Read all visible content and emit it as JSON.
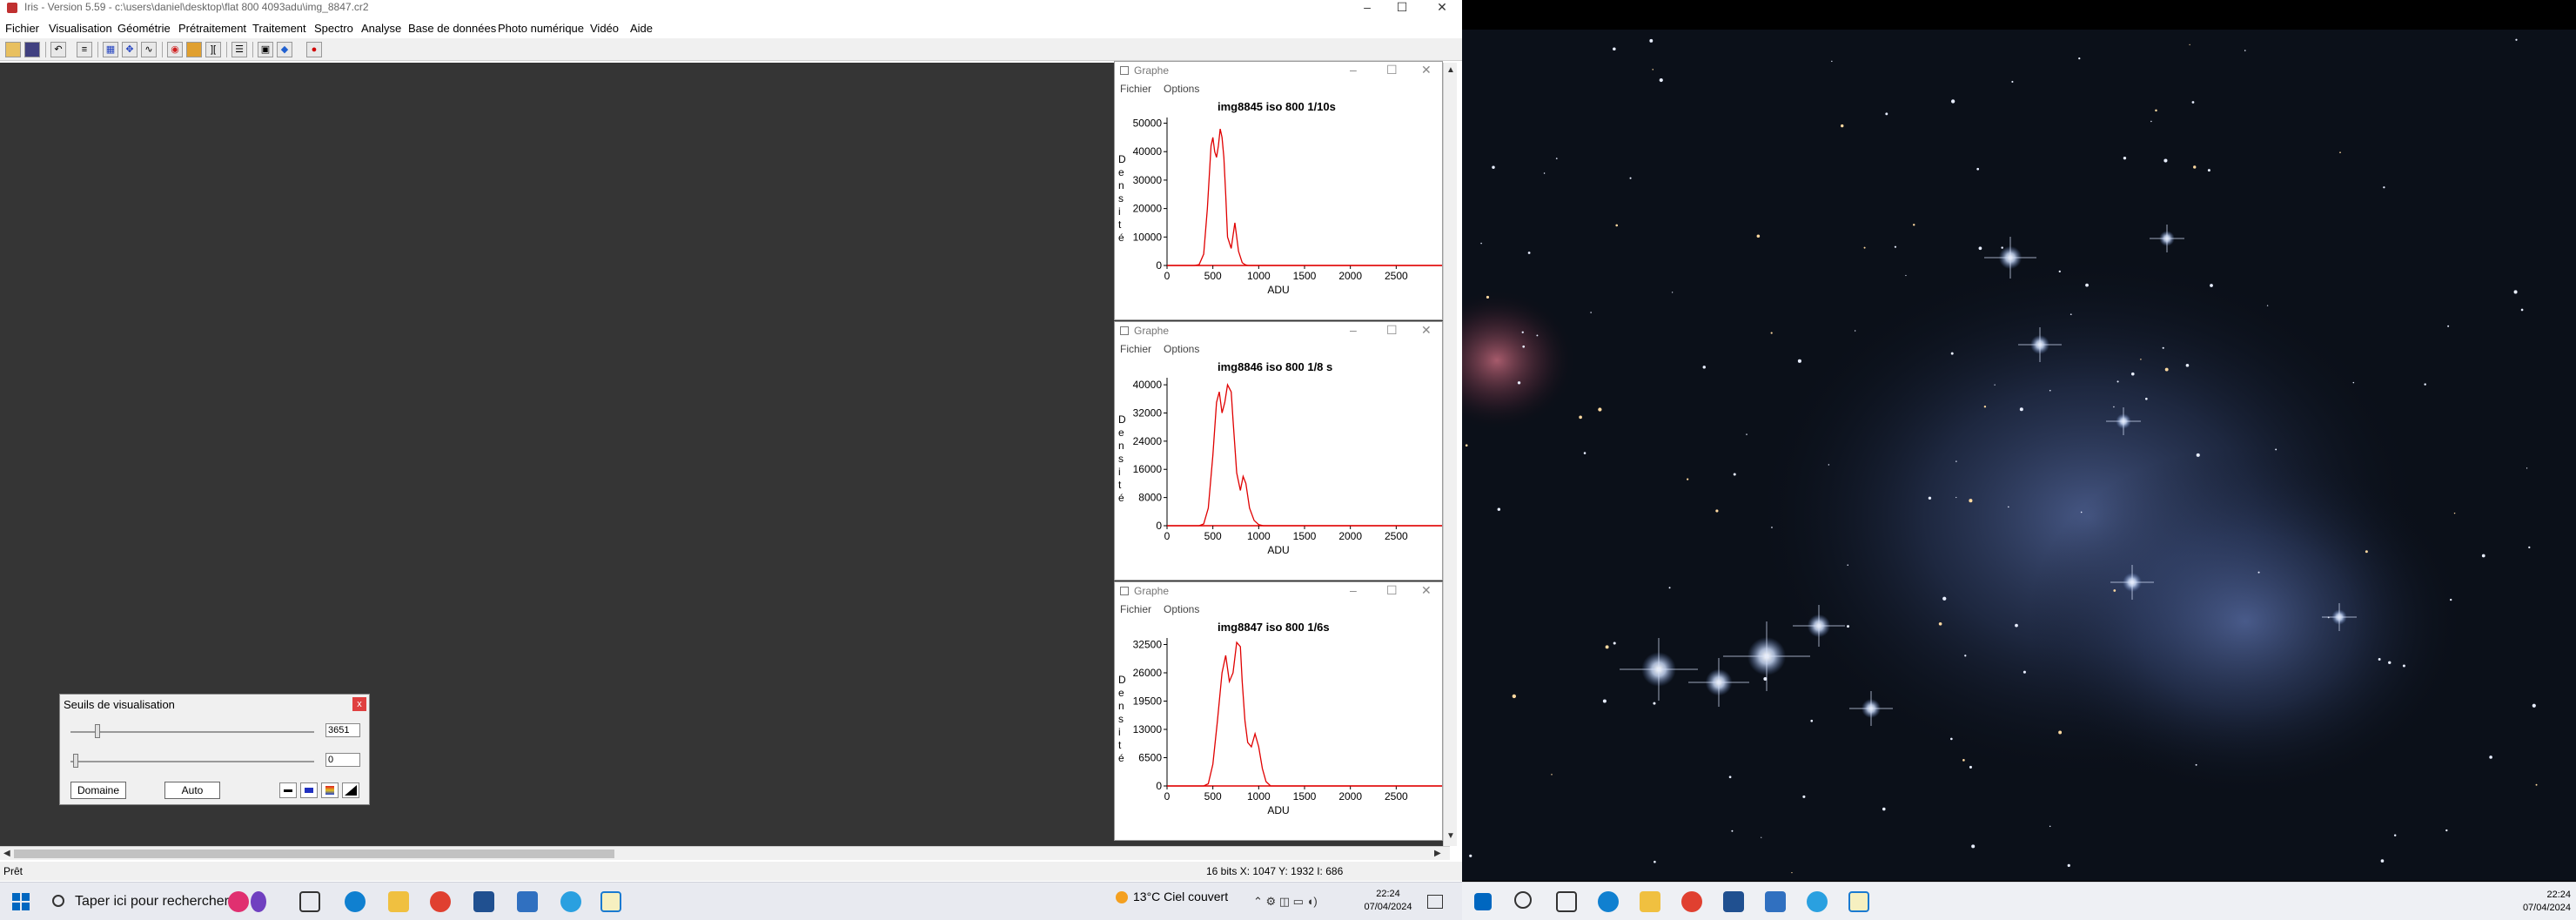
{
  "window": {
    "title": "Iris - Version 5.59 - c:\\users\\daniel\\desktop\\flat 800 4093adu\\img_8847.cr2",
    "controls": [
      "–",
      "☐",
      "✕"
    ]
  },
  "menubar": {
    "items": [
      "Fichier",
      "Visualisation",
      "Géométrie",
      "Prétraitement",
      "Traitement",
      "Spectro",
      "Analyse",
      "Base de données",
      "Photo numérique",
      "Vidéo",
      "Aide"
    ]
  },
  "graphs": [
    {
      "window_title": "Graphe",
      "menu": [
        "Fichier",
        "Options"
      ],
      "chart_data": {
        "type": "line",
        "title": "img8845 iso 800   1/10s",
        "xlabel": "ADU",
        "ylabel": "Densité",
        "xlim": [
          0,
          3000
        ],
        "ylim": [
          0,
          52000
        ],
        "yticks": [
          0,
          10000,
          20000,
          30000,
          40000,
          50000
        ],
        "xticks": [
          0,
          500,
          1000,
          1500,
          2000,
          2500
        ],
        "series": [
          {
            "x": [
              0,
              300,
              350,
              400,
              440,
              480,
              500,
              520,
              540,
              560,
              580,
              600,
              620,
              640,
              660,
              700,
              740,
              780,
              800,
              820,
              850,
              880,
              950,
              3000
            ],
            "values": [
              0,
              0,
              300,
              4000,
              20000,
              42000,
              45000,
              40000,
              38000,
              42000,
              48000,
              45000,
              38000,
              25000,
              10000,
              6000,
              15000,
              5000,
              3000,
              1000,
              300,
              0,
              0,
              0
            ]
          }
        ]
      }
    },
    {
      "window_title": "Graphe",
      "menu": [
        "Fichier",
        "Options"
      ],
      "chart_data": {
        "type": "line",
        "title": "img8846 iso 800   1/8 s",
        "xlabel": "ADU",
        "ylabel": "Densité",
        "xlim": [
          0,
          3000
        ],
        "ylim": [
          0,
          42000
        ],
        "yticks": [
          0,
          8000,
          16000,
          24000,
          32000,
          40000
        ],
        "xticks": [
          0,
          500,
          1000,
          1500,
          2000,
          2500
        ],
        "series": [
          {
            "x": [
              0,
              350,
              400,
              450,
              500,
              540,
              570,
              600,
              630,
              660,
              700,
              720,
              760,
              800,
              830,
              860,
              900,
              950,
              1000,
              1050,
              3000
            ],
            "values": [
              0,
              0,
              500,
              5000,
              20000,
              35000,
              38000,
              32000,
              35000,
              40000,
              38000,
              30000,
              15000,
              10000,
              14000,
              12000,
              5000,
              1500,
              300,
              0,
              0
            ]
          }
        ]
      }
    },
    {
      "window_title": "Graphe",
      "menu": [
        "Fichier",
        "Options"
      ],
      "chart_data": {
        "type": "line",
        "title": "img8847 iso 800   1/6s",
        "xlabel": "ADU",
        "ylabel": "Densité",
        "xlim": [
          0,
          3000
        ],
        "ylim": [
          0,
          34000
        ],
        "yticks": [
          0,
          6500,
          13000,
          19500,
          26000,
          32500
        ],
        "xticks": [
          0,
          500,
          1000,
          1500,
          2000,
          2500
        ],
        "series": [
          {
            "x": [
              0,
              400,
              450,
              500,
              550,
              600,
              640,
              680,
              720,
              760,
              800,
              820,
              850,
              880,
              920,
              960,
              1000,
              1040,
              1080,
              1130,
              3000
            ],
            "values": [
              0,
              0,
              500,
              5000,
              15000,
              26000,
              30000,
              24000,
              26000,
              33000,
              32000,
              24000,
              15000,
              10000,
              9000,
              12000,
              9000,
              4000,
              1000,
              0,
              0
            ]
          }
        ]
      }
    }
  ],
  "threshold_dialog": {
    "title": "Seuils de visualisation",
    "close": "x",
    "high_value": "3651",
    "low_value": "0",
    "high_level": 0.11,
    "low_level": 0.02,
    "domain_button": "Domaine",
    "auto_button": "Auto"
  },
  "statusbar": {
    "left": "Prêt",
    "info": "16 bits  X: 1047  Y: 1932  I: 686"
  },
  "taskbar_left": {
    "search_placeholder": "Taper ici pour rechercher",
    "weather": "13°C  Ciel couvert",
    "time": "22:24",
    "date": "07/04/2024"
  },
  "taskbar_right": {
    "time": "22:24",
    "date": "07/04/2024"
  },
  "colors": {
    "workspace": "#353535",
    "histogram_line": "#e00000",
    "start_blue": "#0067c0"
  }
}
